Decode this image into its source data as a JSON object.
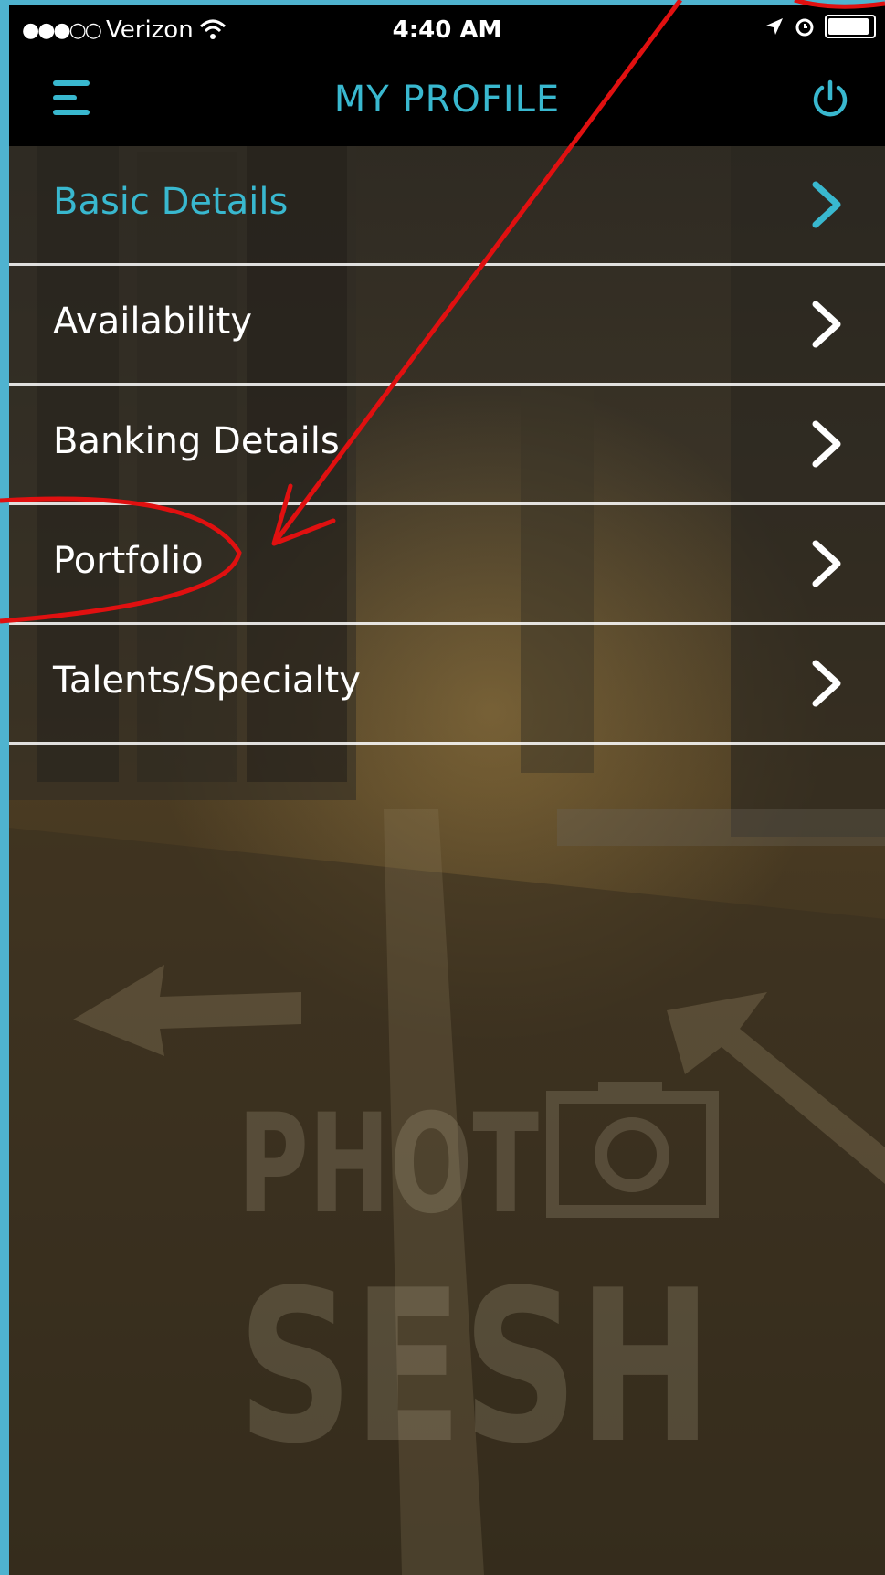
{
  "status_bar": {
    "signal_dots": "●●●○○",
    "carrier": "Verizon",
    "time": "4:40 AM"
  },
  "nav": {
    "title": "MY PROFILE",
    "menu_icon": "hamburger-icon",
    "power_icon": "power-icon"
  },
  "menu": {
    "items": [
      {
        "label": "Basic Details"
      },
      {
        "label": "Availability"
      },
      {
        "label": "Banking Details"
      },
      {
        "label": "Portfolio"
      },
      {
        "label": "Talents/Specialty"
      }
    ]
  },
  "watermark": {
    "line1": "PHOTO",
    "line2": "SESH"
  },
  "colors": {
    "accent": "#39b8cf",
    "frame": "#4fb3cf",
    "annotation": "#e01010"
  }
}
